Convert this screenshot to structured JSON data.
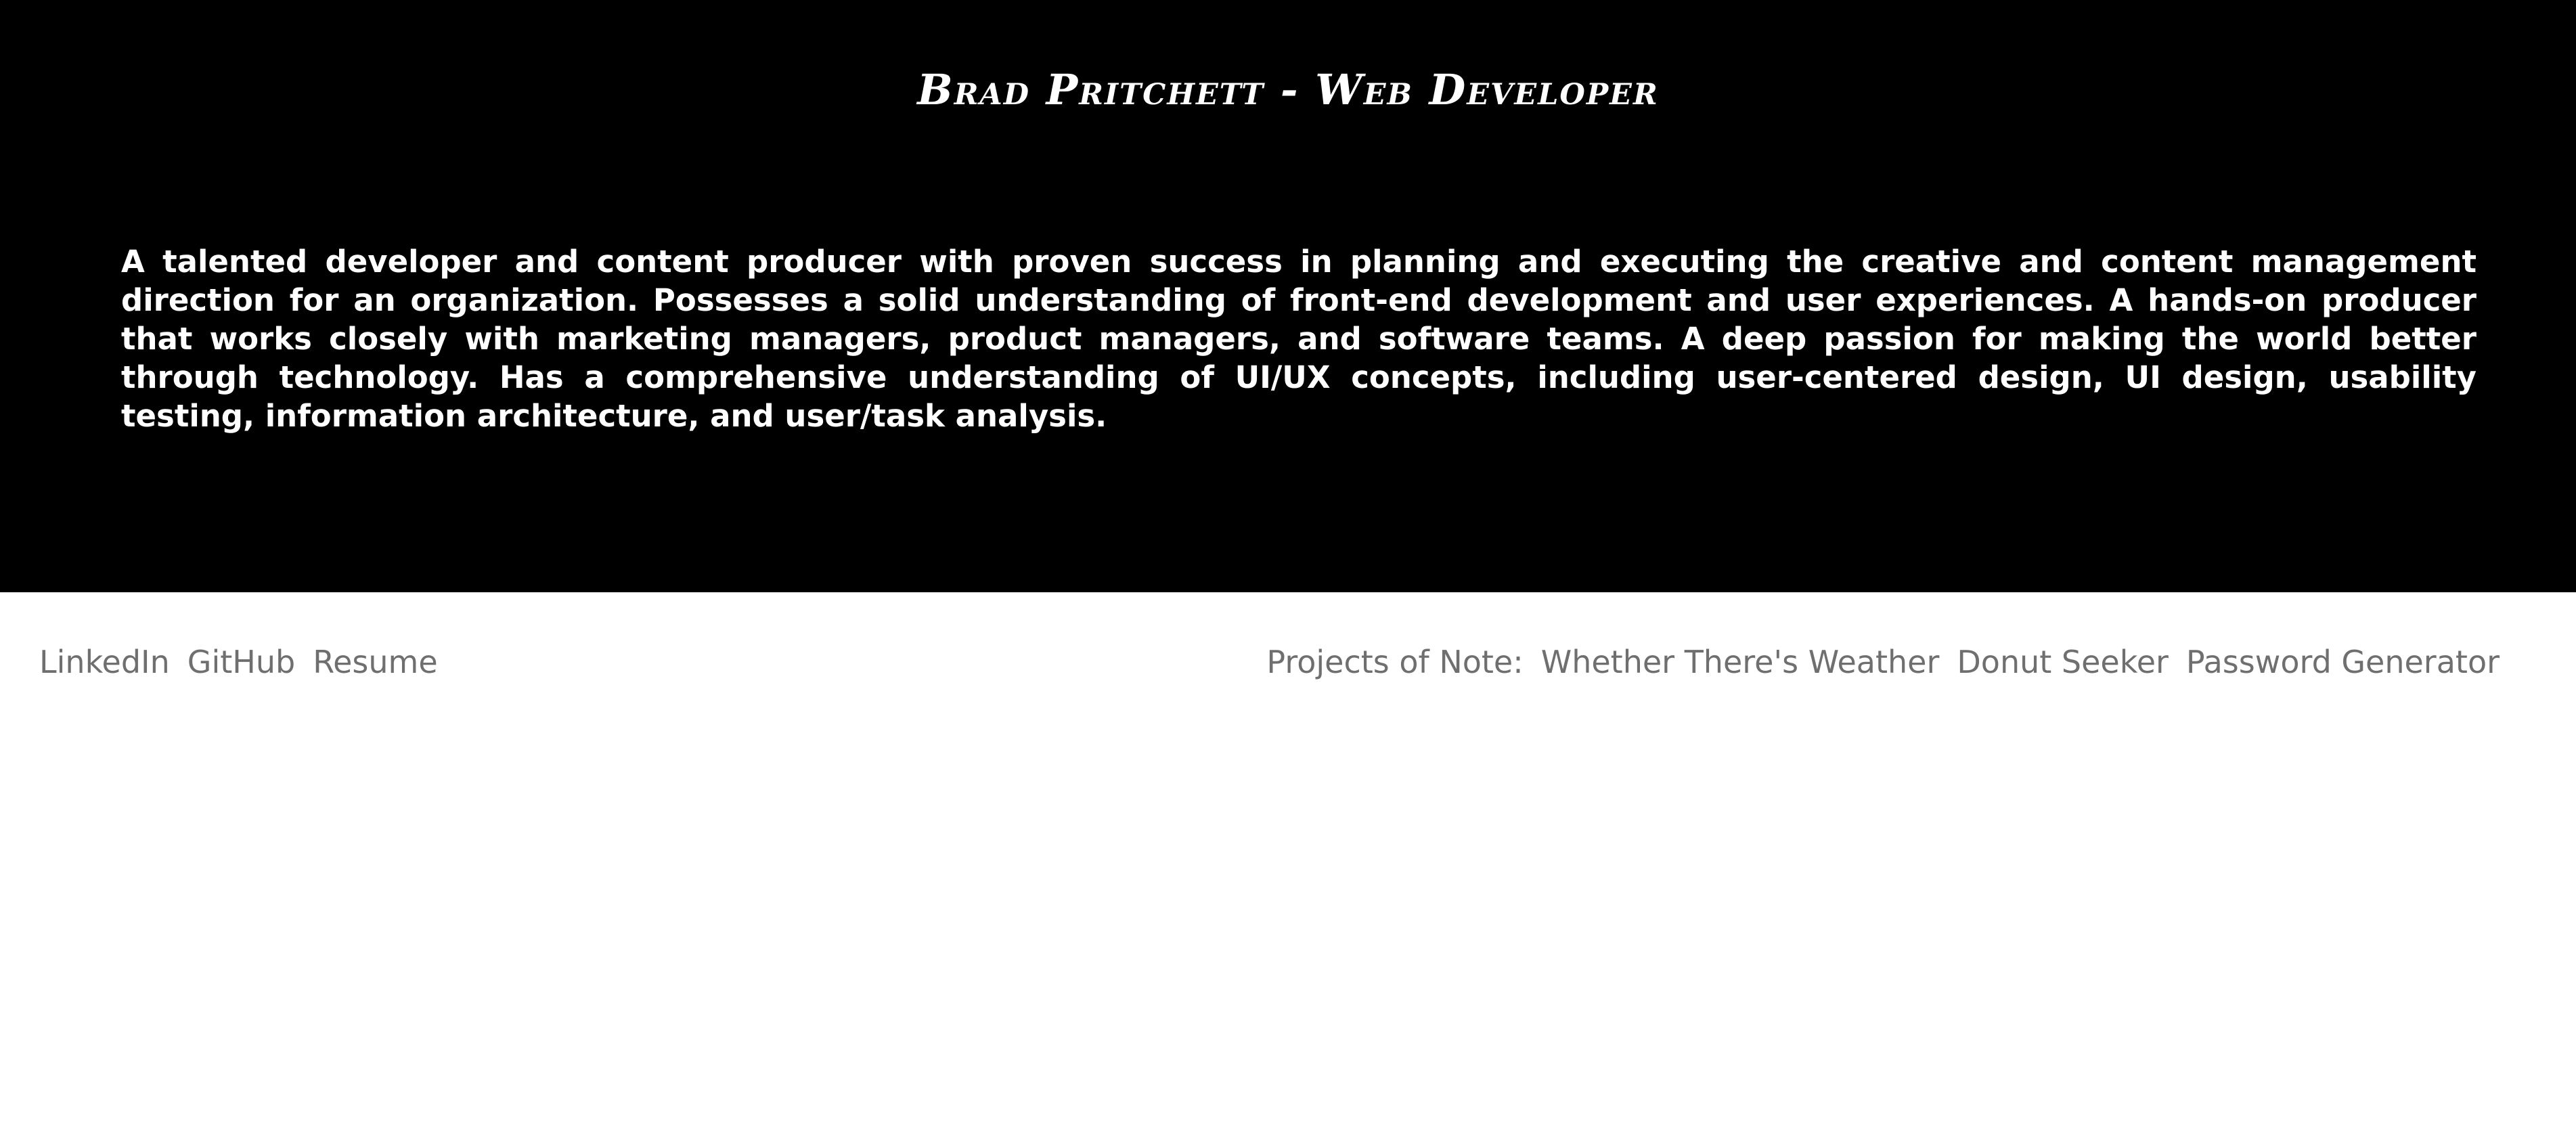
{
  "hero": {
    "title": "Brad Pritchett - Web Developer",
    "bio": "A talented developer and content producer with proven success in planning and executing the creative and content management direction for an organization. Possesses a solid understanding of front-end development and user experiences. A hands-on producer that works closely with marketing managers, product managers, and software teams. A deep passion for making the world better through technology. Has a comprehensive understanding of UI/UX concepts, including user-centered design, UI design, usability testing, information architecture, and user/task analysis."
  },
  "footer": {
    "links": [
      {
        "label": "LinkedIn"
      },
      {
        "label": "GitHub"
      },
      {
        "label": "Resume"
      }
    ],
    "projects_label": "Projects of Note:",
    "projects": [
      {
        "label": "Whether There's Weather"
      },
      {
        "label": "Donut Seeker"
      },
      {
        "label": "Password Generator"
      }
    ]
  },
  "colors": {
    "hero_background": "#000000",
    "hero_text": "#ffffff",
    "page_background": "#ffffff",
    "link_text": "#6f6f6f"
  }
}
